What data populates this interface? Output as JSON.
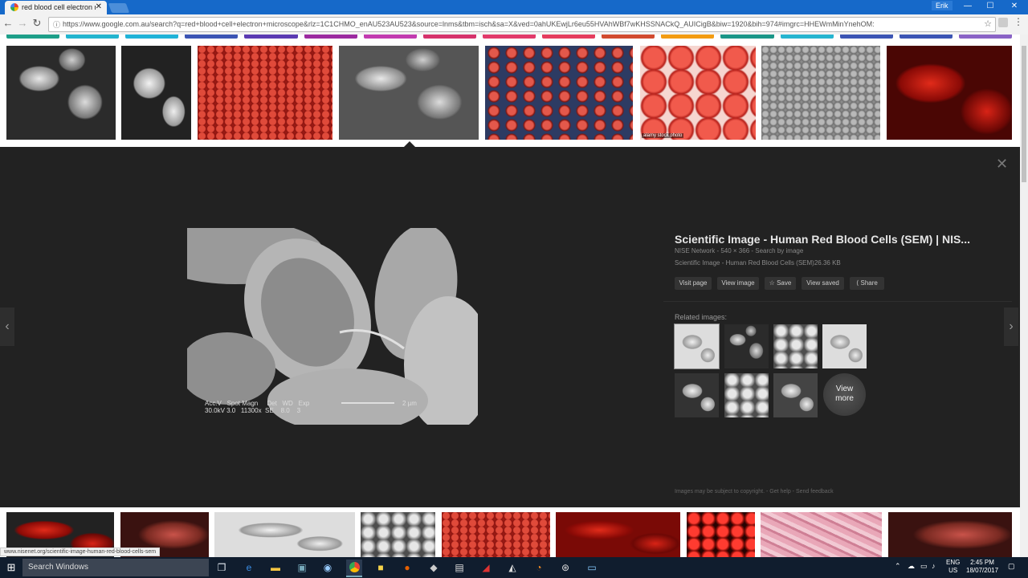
{
  "browser": {
    "tab_title": "red blood cell electron m",
    "tab_close": "✕",
    "user": "Erik",
    "url": "https://www.google.com.au/search?q=red+blood+cell+electron+microscope&rlz=1C1CHMO_enAU523AU523&source=lnms&tbm=isch&sa=X&ved=0ahUKEwjLr6eu55HVAhWBf7wKHSSNACkQ_AUICigB&biw=1920&bih=974#imgrc=HHEWmMinYnehOM:",
    "min": "—",
    "max": "☐",
    "close": "✕"
  },
  "panel": {
    "close_label": "✕",
    "prev_label": "‹",
    "next_label": "›",
    "main_image_caption_top": "Acc.V   Spot Magn     Det   WD   Exp",
    "main_image_caption_bottom": "30.0kV 3.0   11300x  SE    8.0    3",
    "main_image_scale": "2 µm",
    "title": "Scientific Image - Human Red Blood Cells (SEM) | NIS...",
    "meta": "NISE Network - 540 × 366 - Search by image",
    "subtitle": "Scientific Image - Human Red Blood Cells (SEM)26.36 KB",
    "actions": [
      "Visit page",
      "View image",
      "☆ Save",
      "View saved",
      "⟨ Share"
    ],
    "related_label": "Related images:",
    "view_more": "View more",
    "footer": "Images may be subject to copyright. - Get help - Send feedback"
  },
  "status_url": "www.nisenet.org/scientific-image-human-red-blood-cells-sem",
  "top_thumbs_stock_label": "alamy stock photo",
  "taskbar": {
    "search_placeholder": "Search Windows",
    "lang_top": "ENG",
    "lang_bottom": "US",
    "time": "2:45 PM",
    "date": "18/07/2017"
  },
  "colors": {
    "strip": [
      "#1e9f89",
      "#23b5cf",
      "#20b3d8",
      "#3c55b4",
      "#5b3bb3",
      "#9c2ba0",
      "#c23bb0",
      "#d6336c",
      "#e23b6b",
      "#e53d5e",
      "#d24b2f",
      "#f39c12",
      "#1b9688",
      "#26b5d0",
      "#3c55b4",
      "#3c55b4",
      "#8a63c6"
    ]
  }
}
